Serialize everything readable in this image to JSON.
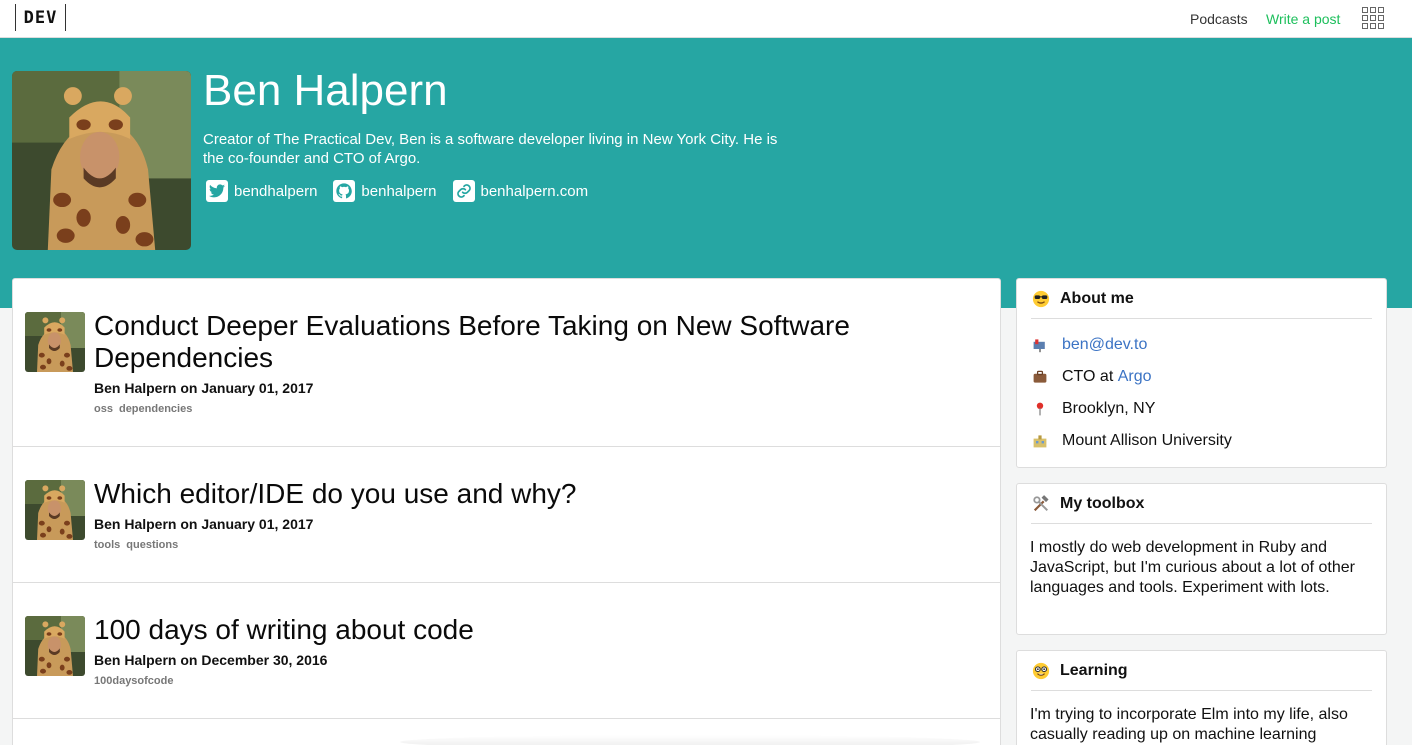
{
  "topbar": {
    "logo_text": "DEV",
    "podcasts_label": "Podcasts",
    "write_label": "Write a post",
    "apps_icon": "grid-icon"
  },
  "profile": {
    "name": "Ben Halpern",
    "bio": "Creator of The Practical Dev, Ben is a software developer living in New York City. He is the co-founder and CTO of Argo.",
    "socials": [
      {
        "icon": "twitter-icon",
        "label": "bendhalpern"
      },
      {
        "icon": "github-icon",
        "label": "benhalpern"
      },
      {
        "icon": "link-icon",
        "label": "benhalpern.com"
      }
    ],
    "header_color": "#26a6a3"
  },
  "articles": [
    {
      "title": "Conduct Deeper Evaluations Before Taking on New Software Dependencies",
      "meta": "Ben Halpern on January 01, 2017",
      "tags": [
        "oss",
        "dependencies"
      ]
    },
    {
      "title": "Which editor/IDE do you use and why?",
      "meta": "Ben Halpern on January 01, 2017",
      "tags": [
        "tools",
        "questions"
      ]
    },
    {
      "title": "100 days of writing about code",
      "meta": "Ben Halpern on December 30, 2016",
      "tags": [
        "100daysofcode"
      ]
    }
  ],
  "sidebar": {
    "about": {
      "heading": "About me",
      "emoji": "sunglasses-emoji",
      "email": "ben@dev.to",
      "job_prefix": "CTO at ",
      "job_company": "Argo",
      "location": "Brooklyn, NY",
      "education": "Mount Allison University"
    },
    "toolbox": {
      "heading": "My toolbox",
      "emoji": "hammer-wrench-emoji",
      "body": "I mostly do web development in Ruby and JavaScript, but I'm curious about a lot of other languages and tools. Experiment with lots."
    },
    "learning": {
      "heading": "Learning",
      "emoji": "nerd-face-emoji",
      "body": "I'm trying to incorporate Elm into my life, also casually reading up on machine learning"
    }
  },
  "colors": {
    "accent_green": "#1dbf5c",
    "link_blue": "#3b73c4"
  }
}
